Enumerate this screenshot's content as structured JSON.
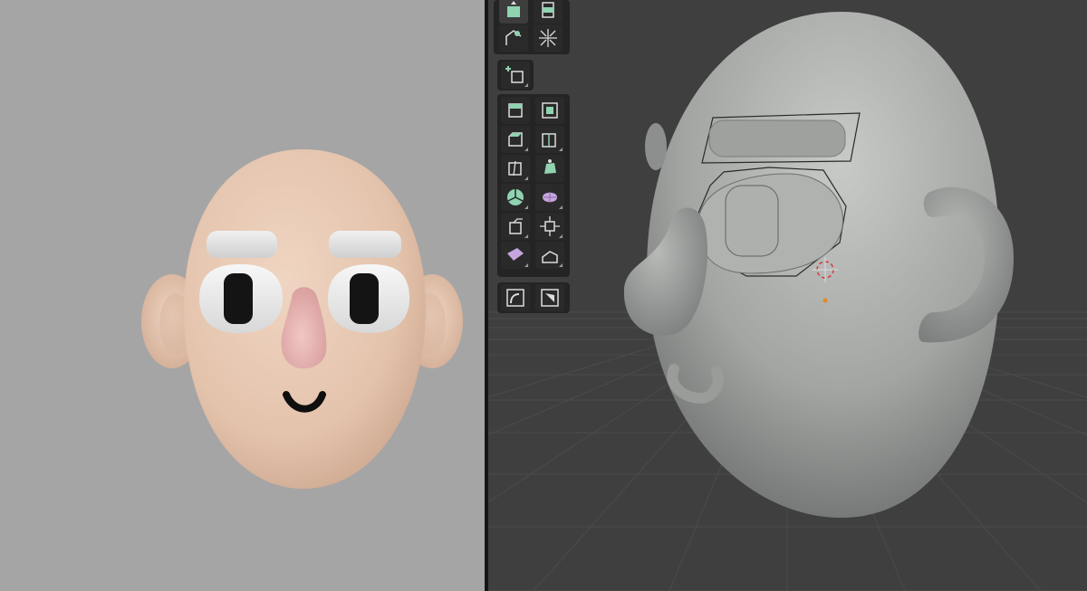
{
  "colors": {
    "render_background": "#a5a5a5",
    "viewport_background": "#3f3f3f",
    "grid_line": "#4c4c4c",
    "skin": "#e7c9b3",
    "nose": "#e8b6b4",
    "eye_white": "#eeeeee",
    "pupil": "#151515",
    "brow": "#e6e6e6",
    "clay": "#a4a6a4",
    "toolbar_bg": "#242424",
    "tool_accent": "#8fd3b0"
  },
  "toolbar": {
    "groups": [
      {
        "name": "transform-group",
        "tools": [
          "move-tool",
          "rotate-tool",
          "annotate-tool",
          "measure-tool"
        ]
      },
      {
        "name": "add-group",
        "tools": [
          "add-cube-tool"
        ]
      },
      {
        "name": "mesh-edit-group",
        "tools": [
          "extrude-tool",
          "inset-tool",
          "bevel-tool",
          "loop-cut-tool",
          "knife-tool",
          "poly-build-tool",
          "spin-tool",
          "smooth-tool",
          "edge-slide-tool",
          "shrink-fatten-tool",
          "shear-tool",
          "rip-tool"
        ]
      },
      {
        "name": "extra-group",
        "tools": [
          "curve-tool",
          "snap-tool"
        ]
      }
    ],
    "active_tool": "move-tool"
  },
  "scene": {
    "objects": [
      "render-head",
      "clay-head"
    ]
  }
}
